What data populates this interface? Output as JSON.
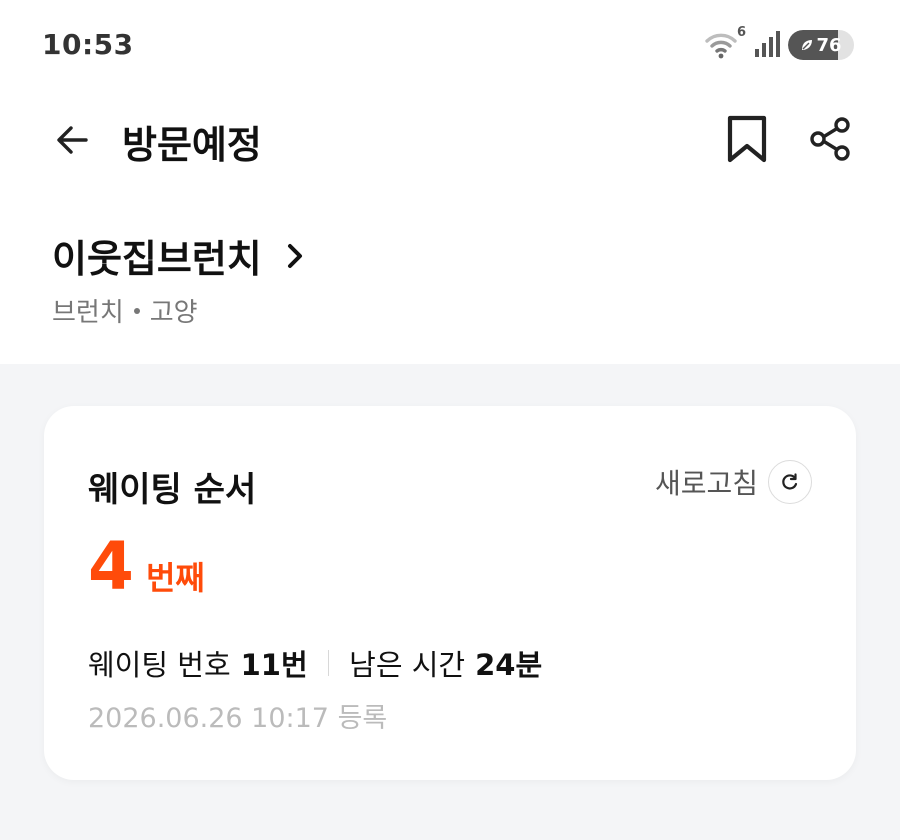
{
  "status_bar": {
    "time": "10:53",
    "network_badge": "6",
    "battery_level": "76",
    "battery_percent": 76
  },
  "header": {
    "title": "방문예정",
    "icons": {
      "back": "arrow-left-icon",
      "bookmark": "bookmark-icon",
      "share": "share-icon"
    }
  },
  "store": {
    "name": "이웃집브런치",
    "category": "브런치",
    "location": "고양"
  },
  "waiting": {
    "title": "웨이팅 순서",
    "refresh_label": "새로고침",
    "order_number": "4",
    "order_suffix": "번째",
    "number_label": "웨이팅 번호",
    "number_value": "11번",
    "remaining_label": "남은 시간",
    "remaining_value": "24분",
    "registered_text": "2026.06.26 10:17 등록"
  },
  "colors": {
    "accent": "#ff4b0a",
    "background_gray": "#f4f5f7",
    "muted_text": "#777777",
    "light_text": "#bbbbbb"
  }
}
